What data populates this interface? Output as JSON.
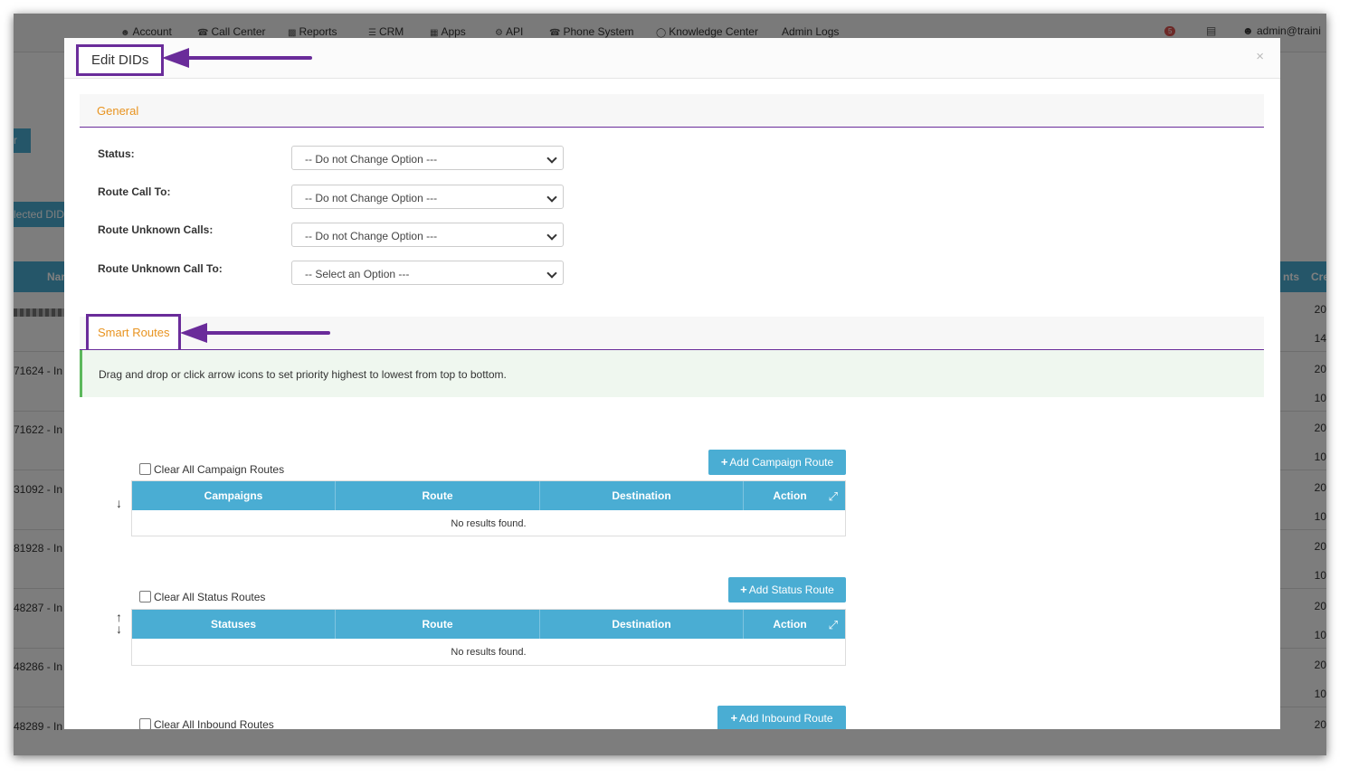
{
  "nav": {
    "items": [
      {
        "icon": "user-icon",
        "label": "Account"
      },
      {
        "icon": "phone-icon",
        "label": "Call Center"
      },
      {
        "icon": "bar-chart-icon",
        "label": "Reports"
      },
      {
        "icon": "list-icon",
        "label": "CRM"
      },
      {
        "icon": "grid-icon",
        "label": "Apps"
      },
      {
        "icon": "gear-icon",
        "label": "API"
      },
      {
        "icon": "phone-icon",
        "label": "Phone System"
      },
      {
        "icon": "lightbulb-icon",
        "label": "Knowledge Center"
      },
      {
        "icon": "",
        "label": "Admin Logs"
      }
    ],
    "notification_count": "5",
    "user_label": "admin@traini"
  },
  "background": {
    "button_fragment": "r",
    "selected_dids_fragment": "lected DID",
    "header_left_fragment": "Nar",
    "header_right_fragments": [
      "nts",
      "Cre"
    ],
    "rows": [
      {
        "left": "",
        "right1": "20",
        "right2": "14"
      },
      {
        "left": "71624 - In",
        "right1": "20",
        "right2": "10"
      },
      {
        "left": "71622 - In",
        "right1": "20",
        "right2": "10"
      },
      {
        "left": "31092 - In",
        "right1": "20",
        "right2": "10"
      },
      {
        "left": "81928 - In",
        "right1": "20",
        "right2": "10"
      },
      {
        "left": "48287 - In",
        "right1": "20",
        "right2": "10"
      },
      {
        "left": "48286 - In",
        "right1": "20",
        "right2": "10"
      },
      {
        "left": "48289 - In",
        "right1": "20",
        "right2": ""
      }
    ]
  },
  "modal": {
    "title": "Edit DIDs",
    "close_symbol": "×",
    "general": {
      "title": "General",
      "fields": [
        {
          "label": "Status:",
          "value": "-- Do not Change Option ---"
        },
        {
          "label": "Route Call To:",
          "value": "-- Do not Change Option ---"
        },
        {
          "label": "Route Unknown Calls:",
          "value": "-- Do not Change Option ---"
        },
        {
          "label": "Route Unknown Call To:",
          "value": "-- Select an Option ---"
        }
      ]
    },
    "smart_routes": {
      "title": "Smart Routes",
      "info": "Drag and drop or click arrow icons to set priority highest to lowest from top to bottom.",
      "campaign": {
        "clear_label": "Clear All Campaign Routes",
        "add_label": "Add Campaign Route",
        "columns": [
          "Campaigns",
          "Route",
          "Destination",
          "Action"
        ],
        "empty_text": "No results found."
      },
      "status": {
        "clear_label": "Clear All Status Routes",
        "add_label": "Add Status Route",
        "columns": [
          "Statuses",
          "Route",
          "Destination",
          "Action"
        ],
        "empty_text": "No results found."
      },
      "inbound": {
        "clear_label": "Clear All Inbound Routes",
        "add_label": "Add Inbound Route"
      }
    }
  },
  "colors": {
    "accent_blue": "#4aadd3",
    "annotation_purple": "#6a2c9a",
    "section_orange": "#e8931f"
  }
}
